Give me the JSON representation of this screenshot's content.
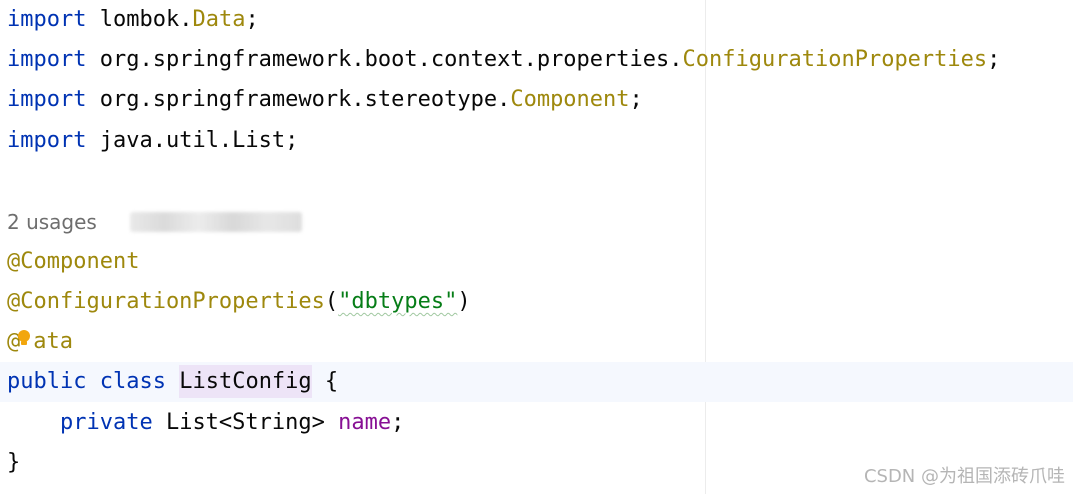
{
  "code": {
    "import_kw": "import",
    "lines": {
      "l1_pkg": " lombok.",
      "l1_cls": "Data",
      "l2_pkg": " org.springframework.boot.context.properties.",
      "l2_cls": "ConfigurationProperties",
      "l3_pkg": " org.springframework.stereotype.",
      "l3_cls": "Component",
      "l4_rest": " java.util.List",
      "semicolon": ";"
    },
    "usages": "2 usages",
    "annotations": {
      "component": "@Component",
      "config_props": "@ConfigurationProperties",
      "config_open": "(",
      "config_arg": "\"dbtypes\"",
      "config_close": ")",
      "data_at": "@",
      "data_rest": "ata"
    },
    "class_decl": {
      "public_kw": "public",
      "class_kw": "class",
      "name": "ListConfig",
      "open_brace": " {"
    },
    "field_decl": {
      "indent": "    ",
      "private_kw": "private",
      "type": " List<String> ",
      "name": "name",
      "semicolon": ";"
    },
    "close_brace": "}"
  },
  "watermark": "CSDN @为祖国添砖爪哇",
  "colors": {
    "keyword": "#0033b3",
    "annotation": "#9e880d",
    "string": "#067d17",
    "field": "#871094",
    "bulb": "#f2a60d"
  },
  "icons": {
    "intention": "lightbulb-icon"
  }
}
